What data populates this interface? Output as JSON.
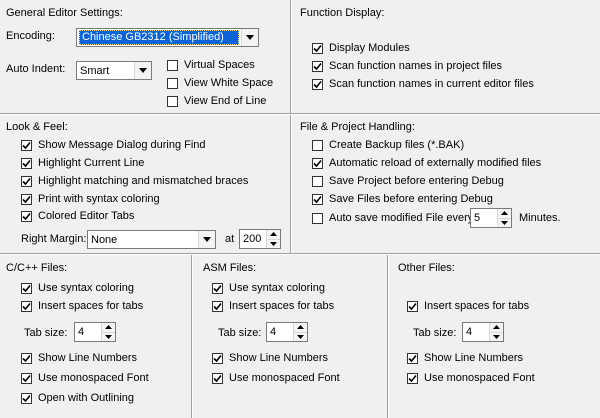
{
  "general": {
    "title": "General Editor Settings:",
    "encoding_label": "Encoding:",
    "encoding_value": "Chinese GB2312 (Simplified)",
    "auto_indent_label": "Auto Indent:",
    "auto_indent_value": "Smart",
    "options": [
      {
        "label": "Virtual Spaces",
        "checked": false
      },
      {
        "label": "View White Space",
        "checked": false
      },
      {
        "label": "View End of Line",
        "checked": false
      }
    ]
  },
  "function_display": {
    "title": "Function Display:",
    "options": [
      {
        "label": "Display Modules",
        "checked": true
      },
      {
        "label": "Scan function names in project files",
        "checked": true
      },
      {
        "label": "Scan function names in current editor files",
        "checked": true
      }
    ]
  },
  "look_feel": {
    "title": "Look & Feel:",
    "options": [
      {
        "label": "Show Message Dialog during Find",
        "checked": true
      },
      {
        "label": "Highlight Current Line",
        "checked": true
      },
      {
        "label": "Highlight matching and mismatched braces",
        "checked": true
      },
      {
        "label": "Print with syntax coloring",
        "checked": true
      },
      {
        "label": "Colored Editor Tabs",
        "checked": true
      }
    ],
    "right_margin_label": "Right Margin:",
    "right_margin_value": "None",
    "at_label": "at",
    "at_value": "200"
  },
  "file_project": {
    "title": "File & Project Handling:",
    "options": [
      {
        "label": "Create Backup files (*.BAK)",
        "checked": false
      },
      {
        "label": "Automatic reload of externally modified files",
        "checked": true
      },
      {
        "label": "Save Project before entering Debug",
        "checked": false
      },
      {
        "label": "Save Files before entering Debug",
        "checked": true
      },
      {
        "label": "Auto save modified File every",
        "checked": false
      }
    ],
    "autosave_value": "5",
    "minutes_label": "Minutes."
  },
  "cpp": {
    "title": "C/C++ Files:",
    "use_syntax": {
      "label": "Use syntax coloring",
      "checked": true
    },
    "insert_spaces": {
      "label": "Insert spaces for tabs",
      "checked": true
    },
    "tab_size_label": "Tab size:",
    "tab_size_value": "4",
    "show_line_numbers": {
      "label": "Show Line Numbers",
      "checked": true
    },
    "monospaced": {
      "label": "Use monospaced Font",
      "checked": true
    },
    "outlining": {
      "label": "Open with Outlining",
      "checked": true
    }
  },
  "asm": {
    "title": "ASM Files:",
    "use_syntax": {
      "label": "Use syntax coloring",
      "checked": true
    },
    "insert_spaces": {
      "label": "Insert spaces for tabs",
      "checked": true
    },
    "tab_size_label": "Tab size:",
    "tab_size_value": "4",
    "show_line_numbers": {
      "label": "Show Line Numbers",
      "checked": true
    },
    "monospaced": {
      "label": "Use monospaced Font",
      "checked": true
    }
  },
  "other": {
    "title": "Other Files:",
    "insert_spaces": {
      "label": "Insert spaces for tabs",
      "checked": true
    },
    "tab_size_label": "Tab size:",
    "tab_size_value": "4",
    "show_line_numbers": {
      "label": "Show Line Numbers",
      "checked": true
    },
    "monospaced": {
      "label": "Use monospaced Font",
      "checked": true
    }
  }
}
